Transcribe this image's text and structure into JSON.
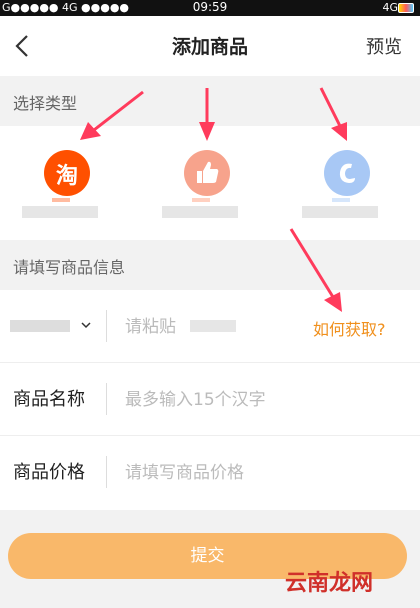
{
  "status": {
    "carrier_left": "G●●●●● 4G ●●●●●",
    "time": "09:59",
    "carrier_right": "4G"
  },
  "navbar": {
    "title": "添加商品",
    "preview_label": "预览"
  },
  "section_type": {
    "title": "选择类型"
  },
  "types": [
    {
      "icon": "taobao-icon",
      "glyph": "淘",
      "color": "#ff5000"
    },
    {
      "icon": "thumbs-up-icon",
      "glyph": "",
      "color": "#f7a38c"
    },
    {
      "icon": "c-logo-icon",
      "glyph": "",
      "color": "#a8c8f5"
    }
  ],
  "section_info": {
    "title": "请填写商品信息"
  },
  "form": {
    "link_placeholder": "请粘贴",
    "how_to_get": "如何获取?",
    "name_label": "商品名称",
    "name_placeholder": "最多输入15个汉字",
    "price_label": "商品价格",
    "price_placeholder": "请填写商品价格"
  },
  "submit_label": "提交",
  "watermark": "云南龙网",
  "colors": {
    "accent": "#f0901d",
    "submit_bg": "#f9b86a",
    "arrow": "#ff3b5c"
  }
}
